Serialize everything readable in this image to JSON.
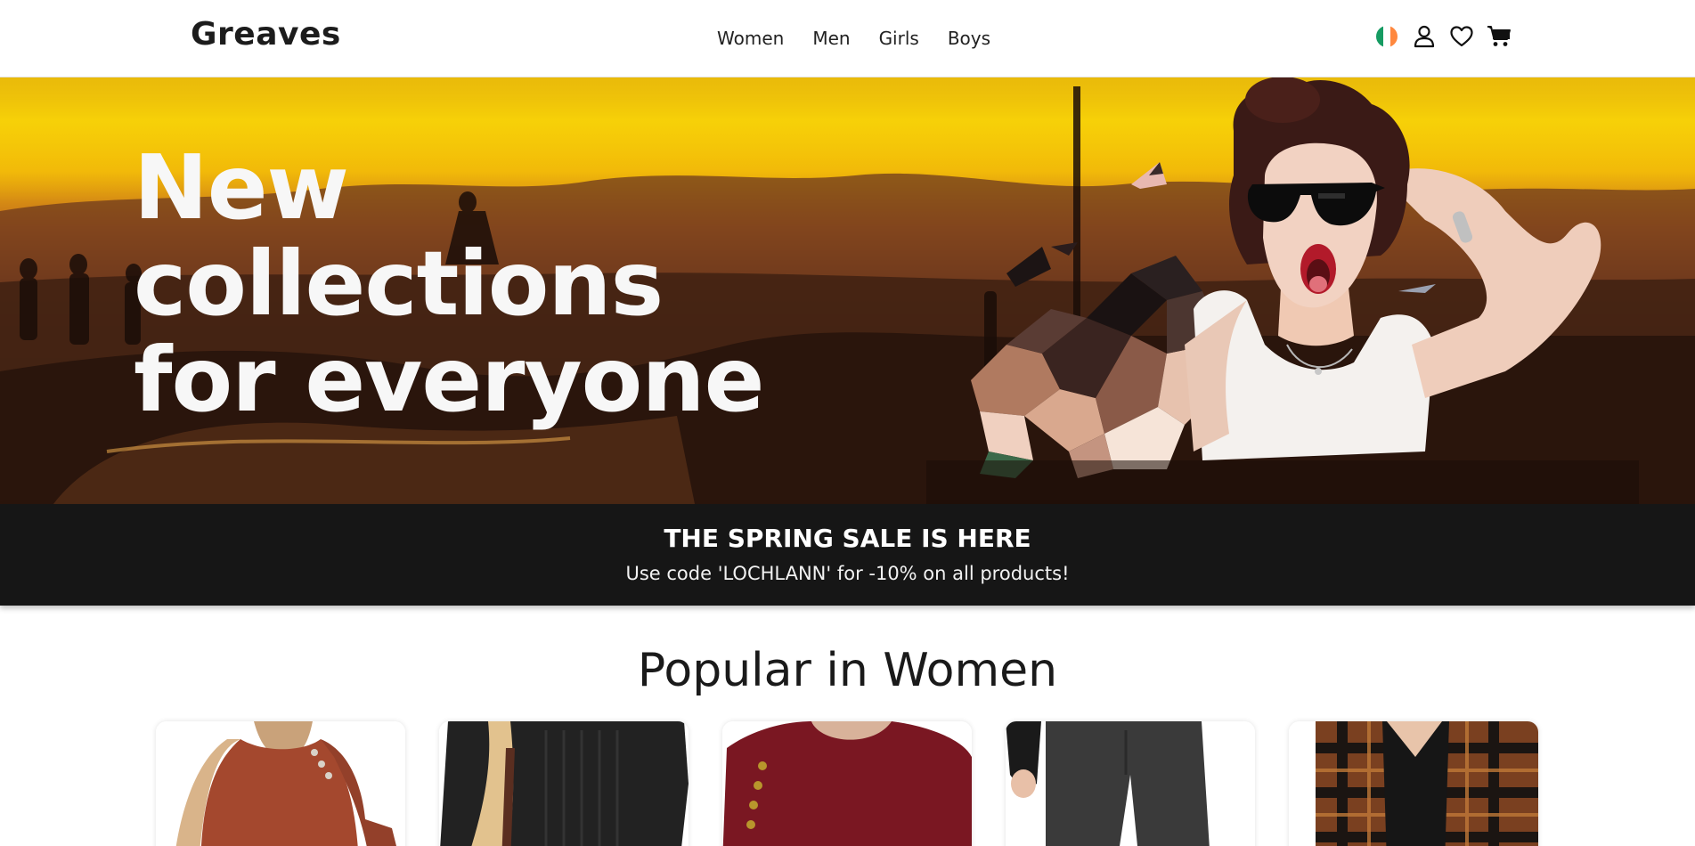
{
  "header": {
    "logo": "Greaves",
    "nav": [
      {
        "label": "Women"
      },
      {
        "label": "Men"
      },
      {
        "label": "Girls"
      },
      {
        "label": "Boys"
      }
    ],
    "icons": [
      "ireland-flag-icon",
      "user-icon",
      "heart-icon",
      "cart-icon"
    ]
  },
  "hero": {
    "title_lines": [
      "New",
      "collections",
      "for everyone"
    ]
  },
  "sale": {
    "title": "THE SPRING SALE IS HERE",
    "subtitle": "Use code 'LOCHLANN' for -10% on all products!"
  },
  "popular": {
    "title": "Popular in Women",
    "products": [
      {
        "color": "#a4482e",
        "name": "product-rust-sweater"
      },
      {
        "color": "#222222",
        "name": "product-black-knit"
      },
      {
        "color": "#7a1722",
        "name": "product-burgundy-top"
      },
      {
        "color": "#3a3a3a",
        "name": "product-grey-trousers"
      },
      {
        "color": "#7a4020",
        "name": "product-plaid-shirt"
      }
    ]
  },
  "colors": {
    "header_bg": "#ffffff",
    "sale_bg": "#161616",
    "hero_text": "#f7f7f7",
    "flag_green": "#169b62",
    "flag_white": "#ffffff",
    "flag_orange": "#ff883e"
  }
}
